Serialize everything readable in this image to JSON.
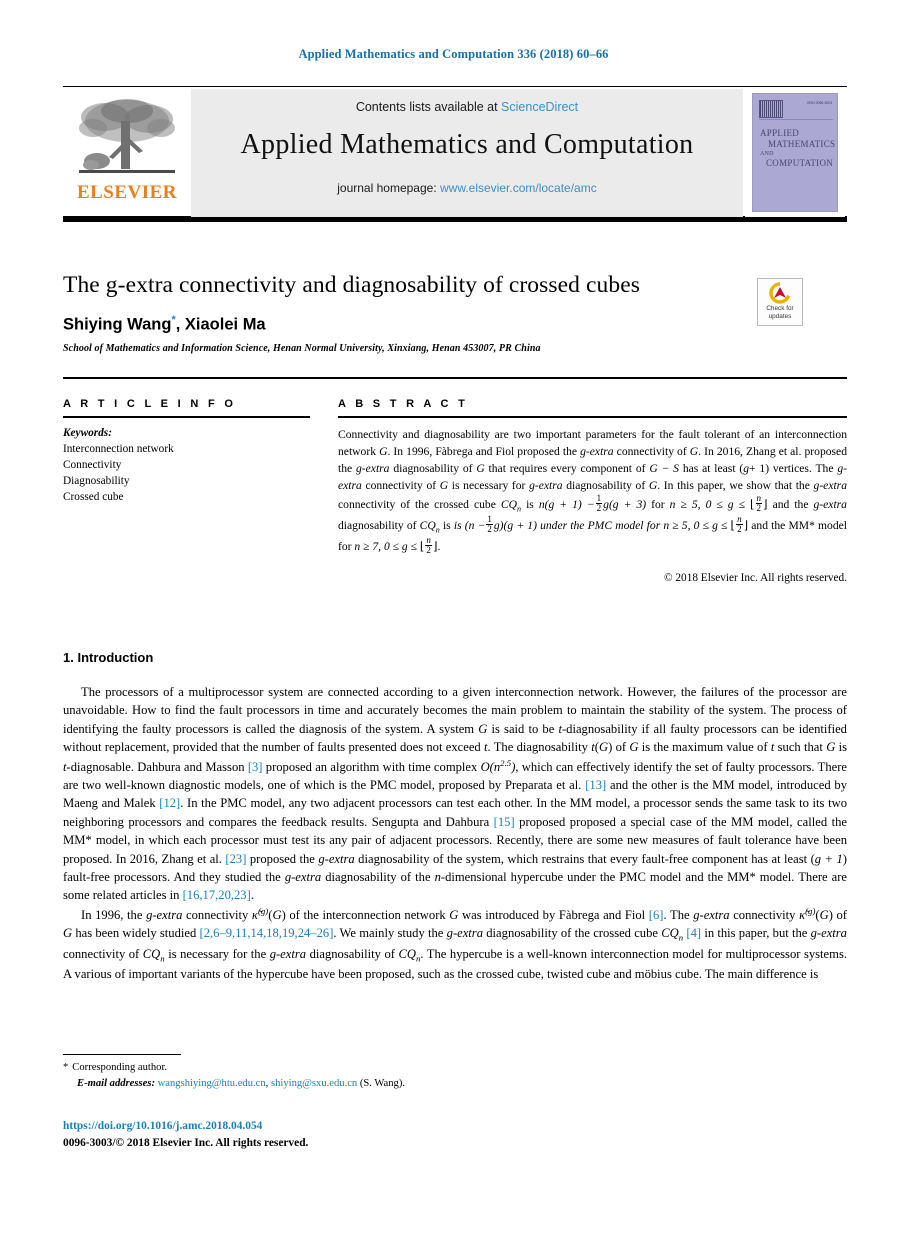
{
  "running_head": "Applied Mathematics and Computation 336 (2018) 60–66",
  "masthead": {
    "contents_prefix": "Contents lists available at ",
    "sciencedirect": "ScienceDirect",
    "journal_title": "Applied Mathematics and Computation",
    "homepage_prefix": "journal homepage: ",
    "homepage_url": "www.elsevier.com/locate/amc",
    "publisher_wordmark": "ELSEVIER",
    "cover": {
      "line1": "APPLIED",
      "line2": "MATHEMATICS",
      "line3": "AND",
      "line4": "COMPUTATION",
      "issn": "ISSN 0096-3003"
    },
    "colors": {
      "band_bg": "#ebebeb",
      "link_blue": "#3a8fc4",
      "elsevier_orange": "#ef7d1a",
      "cover_purple": "#aba9d4"
    }
  },
  "article": {
    "title": "The g-extra connectivity and diagnosability of crossed cubes",
    "authors": "Shiying Wang",
    "author_marker": "*",
    "authors_rest": ", Xiaolei Ma",
    "affiliation": "School of Mathematics and Information Science, Henan Normal University, Xinxiang, Henan 453007, PR China",
    "crossmark": {
      "line1": "Check for",
      "line2": "updates"
    }
  },
  "info": {
    "heading": "A R T I C L E   I N F O",
    "keywords_label": "Keywords:",
    "keywords": [
      "Interconnection network",
      "Connectivity",
      "Diagnosability",
      "Crossed cube"
    ]
  },
  "abstract": {
    "heading": "A B S T R A C T",
    "part1": "Connectivity and diagnosability are two important parameters for the fault tolerant of an interconnection network ",
    "g1": "G",
    "part2": ". In 1996, Fàbrega and Fiol proposed the ",
    "gextra1": "g-extra",
    "part3": " connectivity of ",
    "g2": "G",
    "part4": ". In 2016, Zhang et al. proposed the ",
    "gextra2": "g-extra",
    "part5": " diagnosability of ",
    "g3": "G",
    "part6": " that requires every component of ",
    "gs": "G − S",
    "part7": " has at least (",
    "gplus": "g",
    "part8": "+ 1) vertices. The ",
    "gextra3": "g-extra",
    "part9": " connectivity of ",
    "g4": "G",
    "part10": " is necessary for ",
    "gextra4": "g-extra",
    "part11": " diagnosability of ",
    "g5": "G",
    "part12": ". In this paper, we show that the ",
    "gextra5": "g-extra",
    "part13": " connectivity of the crossed cube ",
    "cq1": "CQ",
    "cq1sub": "n",
    "part14": " is ",
    "f1": "n(g + 1) −",
    "f1b": "g(g + 3)",
    "part15": " for ",
    "f2": "n ≥ 5, 0 ≤ g ≤ ",
    "floor_open": "⌊",
    "floor_close": "⌋",
    "fracn": "n",
    "frac2": "2",
    "part16": " and the ",
    "gextra6": "g-extra",
    "part17": " diagnosability of ",
    "cq2": "CQ",
    "cq2sub": "n",
    "part18": " is (n −",
    "part18b": "g)(g + 1) under the PMC model for ",
    "part19": "n ≥ 5, 0 ≤ g ≤ ",
    "part20": " and the MM",
    "mmstar": "*",
    "part21": " model for ",
    "part22": "n ≥ 7, 0 ≤ g ≤ ",
    "part23": ".",
    "copyright": "© 2018 Elsevier Inc. All rights reserved."
  },
  "body": {
    "section_heading": "1. Introduction",
    "paragraph1": {
      "t1": "The processors of a multiprocessor system are connected according to a given interconnection network. However, the failures of the processor are unavoidable. How to find the fault processors in time and accurately becomes the main problem to maintain the stability of the system. The process of identifying the faulty processors is called the diagnosis of the system. A system ",
      "g1": "G",
      "t2": " is said to be ",
      "t_it1": "t",
      "t3": "-diagnosability if all faulty processors can be identified without replacement, provided that the number of faults presented does not exceed ",
      "t_it2": "t",
      "t4": ". The diagnosability ",
      "t_it3": "t",
      "t5": "(",
      "g2": "G",
      "t6": ") of ",
      "g3": "G",
      "t7": " is the maximum value of ",
      "t_it4": "t",
      "t8": " such that ",
      "g4": "G",
      "t9": " is ",
      "t_it5": "t",
      "t10": "-diagnosable. Dahbura and Masson ",
      "ref3": "[3]",
      "t11": " proposed an algorithm with time complex ",
      "bigo": "O(n",
      "bigo_sup": "2.5",
      "bigo2": ")",
      "t12": ", which can effectively identify the set of faulty processors. There are two well-known diagnostic models, one of which is the PMC model, proposed by Preparata et al. ",
      "ref13": "[13]",
      "t13": " and the other is the MM model, introduced by Maeng and Malek ",
      "ref12": "[12]",
      "t14": ". In the PMC model, any two adjacent processors can test each other. In the MM model, a processor sends the same task to its two neighboring processors and compares the feedback results. Sengupta and Dahbura ",
      "ref15": "[15]",
      "t15": " proposed proposed a special case of the MM model, called the MM* model, in which each processor must test its any pair of adjacent processors. Recently, there are some new measures of fault tolerance have been proposed. In 2016, Zhang et al. ",
      "ref23": "[23]",
      "t16": " proposed the ",
      "gextra1": "g-extra",
      "t17": " diagnosability of the system, which restrains that every fault-free component has at least (",
      "gp1": "g + 1",
      "t18": ") fault-free processors. And they studied the ",
      "gextra2": "g-extra",
      "t19": " diagnosability of the ",
      "n_it": "n",
      "t20": "-dimensional hypercube under the PMC model and the MM* model. There are some related articles in ",
      "ref16": "[16,17,20,23]",
      "t21": "."
    },
    "paragraph2": {
      "t1": "In 1996, the ",
      "gextra1": "g-extra",
      "t2": " connectivity ",
      "kappa1": "κ̃",
      "kappa1_sup": "(g)",
      "t3": "(",
      "g1": "G",
      "t4": ") of the interconnection network ",
      "g2": "G",
      "t5": " was introduced by Fàbrega and Fiol ",
      "ref6": "[6]",
      "t6": ". The ",
      "gextra2": "g-extra",
      "t7": " connectivity ",
      "kappa2": "κ̃",
      "kappa2_sup": "(g)",
      "t8": "(",
      "g3": "G",
      "t9": ") of ",
      "g4": "G",
      "t10": " has been widely studied ",
      "ref_list": "[2,6–9,11,14,18,19,24–26]",
      "t11": ". We mainly study the ",
      "gextra3": "g-extra",
      "t12": " diagnosability of the crossed cube ",
      "cq1": "CQ",
      "cq1sub": "n",
      "t13": " ",
      "ref4": "[4]",
      "t14": " in this paper, but the ",
      "gextra4": "g-extra",
      "t15": " connectivity of ",
      "cq2": "CQ",
      "cq2sub": "n",
      "t16": " is necessary for the ",
      "gextra5": "g-extra",
      "t17": " diagnosability of ",
      "cq3": "CQ",
      "cq3sub": "n",
      "t18": ". The hypercube is a well-known interconnection model for multiprocessor systems. A various of important variants of the hypercube have been proposed, such as the crossed cube, twisted cube and möbius cube. The main difference is"
    }
  },
  "footer": {
    "corresponding_marker": "*",
    "corresponding_label": "Corresponding author.",
    "email_label": "E-mail addresses:",
    "email1": "wangshiying@htu.edu.cn",
    "email_sep": ", ",
    "email2": "shiying@sxu.edu.cn",
    "email_suffix": " (S. Wang).",
    "doi": "https://doi.org/10.1016/j.amc.2018.04.054",
    "issn_copyright": "0096-3003/© 2018 Elsevier Inc. All rights reserved."
  }
}
